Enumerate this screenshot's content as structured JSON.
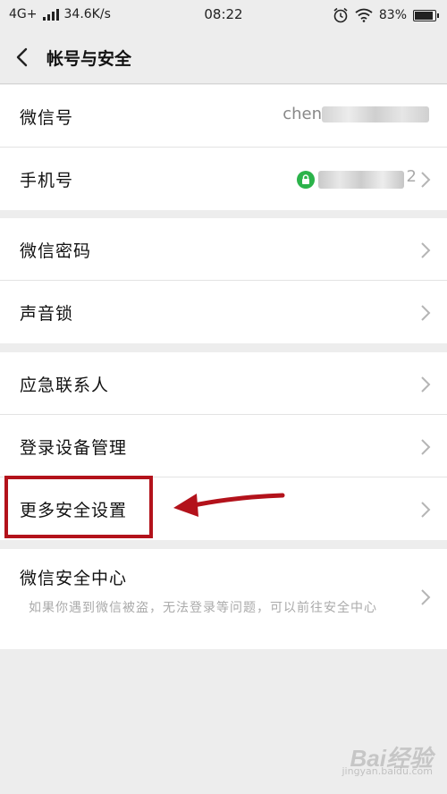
{
  "status_bar": {
    "network": "4G+",
    "speed": "34.6K/s",
    "time": "08:22",
    "battery": "83%",
    "battery_level": 0.83,
    "icons": [
      "signal-icon",
      "alarm-icon",
      "wifi-icon",
      "battery-icon"
    ]
  },
  "header": {
    "title": "帐号与安全"
  },
  "sections": {
    "account": {
      "wechat_id_label": "微信号",
      "wechat_id_value": "chen",
      "phone_label": "手机号",
      "phone_tail": "2"
    },
    "security": {
      "password_label": "微信密码",
      "voice_lock_label": "声音锁"
    },
    "devices": {
      "emergency_label": "应急联系人",
      "device_mgmt_label": "登录设备管理",
      "more_security_label": "更多安全设置"
    },
    "center": {
      "title": "微信安全中心",
      "desc": "如果你遇到微信被盗，无法登录等问题，可以前往安全中心"
    }
  },
  "watermark": {
    "brand": "Bai经验",
    "sub": "jingyan.baidu.com"
  },
  "colors": {
    "highlight": "#b3121b",
    "lock_badge": "#2bb34a",
    "background": "#ededed"
  }
}
